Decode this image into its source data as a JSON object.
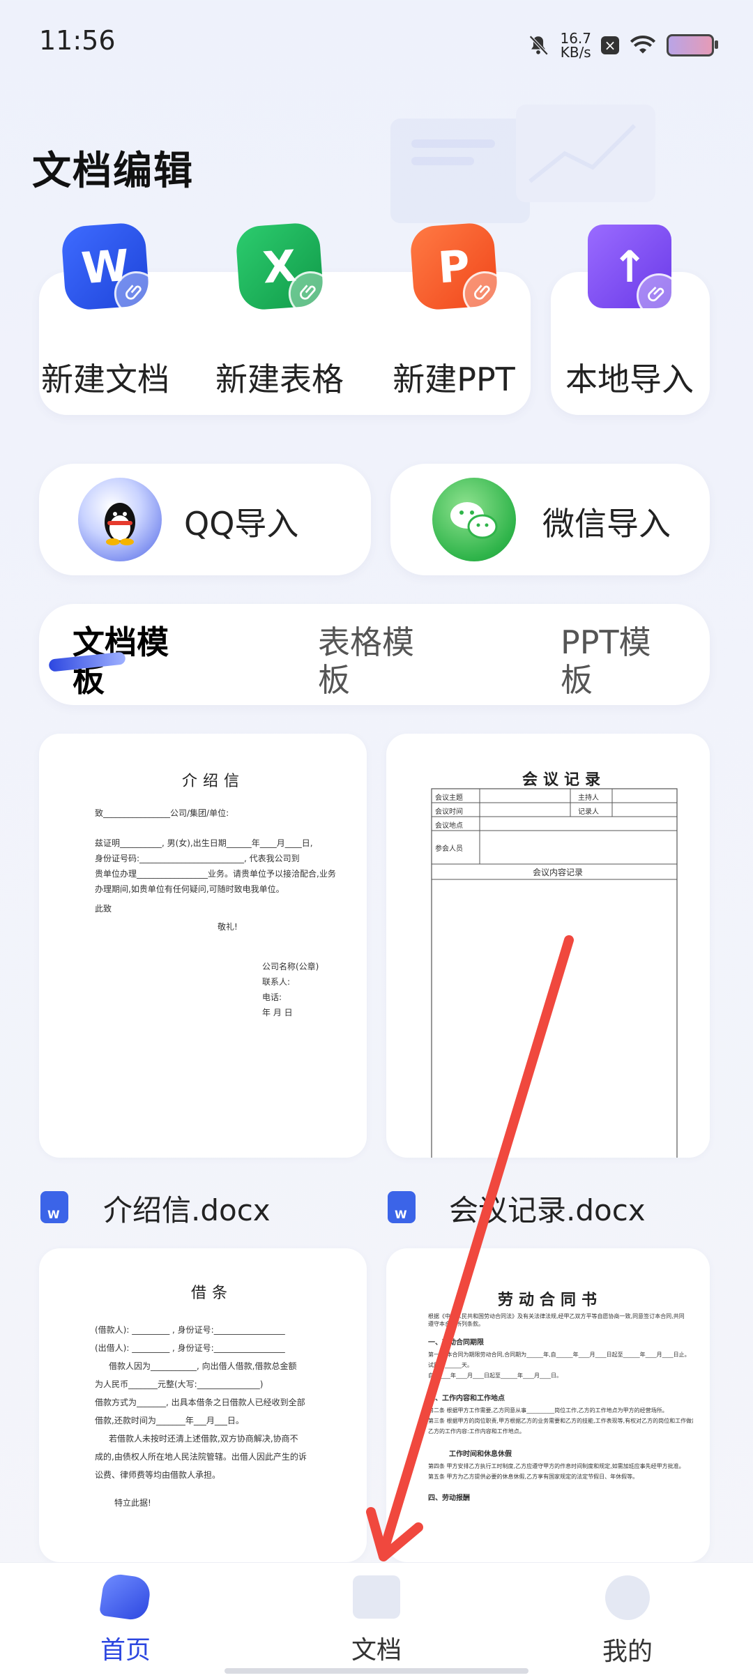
{
  "status_bar": {
    "time": "11:56",
    "speed_value": "16.7",
    "speed_unit": "KB/s"
  },
  "page_title": "文档编辑",
  "tools": [
    {
      "label": "新建文档",
      "glyph": "W",
      "color": "#2f56e8"
    },
    {
      "label": "新建表格",
      "glyph": "X",
      "color": "#1fb35a"
    },
    {
      "label": "新建PPT",
      "glyph": "P",
      "color": "#ff5a2c"
    },
    {
      "label": "本地导入",
      "glyph": "↑",
      "color": "#7b4bf0"
    }
  ],
  "imports": [
    {
      "label": "QQ导入"
    },
    {
      "label": "微信导入"
    }
  ],
  "tabs": [
    {
      "label": "文档模板",
      "active": true
    },
    {
      "label": "表格模板",
      "active": false
    },
    {
      "label": "PPT模板",
      "active": false
    }
  ],
  "templates": [
    {
      "file_name": "介绍信.docx",
      "title": "介绍信",
      "lines": [
        "致________________公司/集团/单位:",
        "兹证明__________, 男(女),出生日期______年____月____日,",
        "身份证号码:_________________________, 代表我公司到",
        "贵单位办理_________________业务。请贵单位予以接洽配合,业务",
        "办理期间,如贵单位有任何疑问,可随时致电我单位。",
        "此致",
        "敬礼!",
        "公司名称(公章)",
        "联系人:",
        "电话:",
        "年    月    日"
      ]
    },
    {
      "file_name": "会议记录.docx",
      "title": "会议记录",
      "cells": [
        "会议主题",
        "主持人",
        "会议时间",
        "记录人",
        "会议地点",
        "参会人员",
        "会议内容记录"
      ]
    },
    {
      "title": "借条",
      "lines": [
        "(借款人): _________ , 身份证号:_________________",
        "(出借人): _________ , 身份证号:_________________",
        "借款人因为___________, 向出借人借款,借款总金额",
        "为人民币_______元整(大写:_______________)",
        "借款方式为_______, 出具本借条之日借款人已经收到全部",
        "借款,还款时间为_______年___月___日。",
        "若借款人未按时还清上述借款,双方协商解决,协商不",
        "成的,由债权人所在地人民法院管辖。出借人因此产生的诉",
        "讼费、律师费等均由借款人承担。",
        "特立此据!"
      ]
    },
    {
      "title": "劳动合同书",
      "lines": [
        "根据《中华人民共和国劳动合同法》及有关法律法规,经甲乙双方平等自愿协商一致,同意签订本合同,共同",
        "遵守本合同所列条款。",
        "一、劳动合同期限",
        "第一条 本合同为期限劳动合同,合同期为______年,自______年____月____日起至______年____月____日止。",
        "试用期______天。",
        "自______年____月____日起至______年____月____日。",
        "二、工作内容和工作地点",
        "第二条 根据甲方工作需要,乙方同意从事__________岗位工作,乙方的工作地点为甲方的经营场所。",
        "第三条 根据甲方的岗位职责,甲方根据乙方的业务需要和乙方的技能,工作表现等,有权对乙方的岗位和工作做出调整。",
        "乙方的工作内容:工作内容和工作地点。",
        "工作时间和休息休假",
        "第四条 甲方安排乙方执行工时制度,乙方应遵守甲方的作息时间制度和规定,如需加班应事先经甲方批准。",
        "第五条 甲方为乙方提供必要的休息休假,乙方享有国家规定的法定节假日、年休假等。",
        "四、劳动报酬"
      ]
    }
  ],
  "nav": [
    {
      "label": "首页",
      "active": true
    },
    {
      "label": "文档",
      "active": false
    },
    {
      "label": "我的",
      "active": false
    }
  ]
}
